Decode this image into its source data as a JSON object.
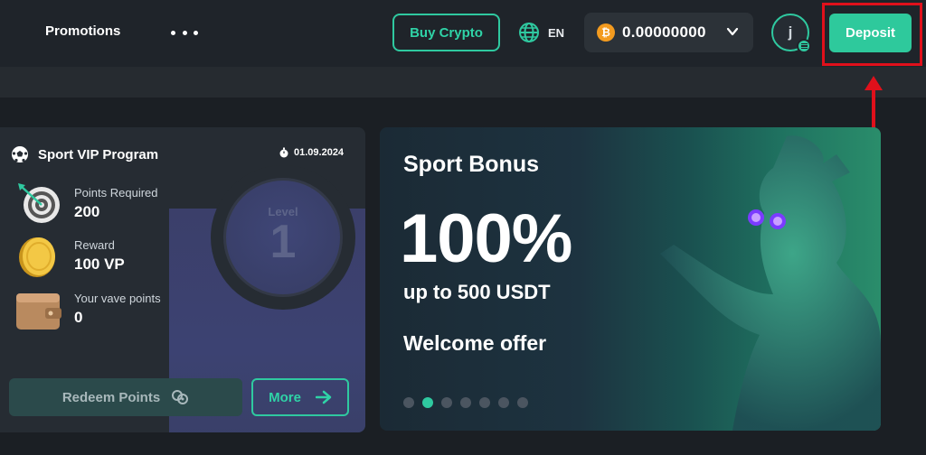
{
  "header": {
    "promotions_label": "Promotions",
    "buy_crypto_label": "Buy Crypto",
    "language": "EN",
    "balance": "0.00000000",
    "currency_icon": "bitcoin-icon",
    "avatar_letter": "j",
    "deposit_label": "Deposit"
  },
  "vip": {
    "title": "Sport VIP Program",
    "date": "01.09.2024",
    "level_label": "Level",
    "level_value": "1",
    "stats": [
      {
        "label": "Points Required",
        "value": "200",
        "icon": "target-icon"
      },
      {
        "label": "Reward",
        "value": "100 VP",
        "icon": "coin-icon"
      },
      {
        "label": "Your vave points",
        "value": "0",
        "icon": "wallet-icon"
      }
    ],
    "redeem_label": "Redeem Points",
    "more_label": "More"
  },
  "banner": {
    "title": "Sport Bonus",
    "headline": "100%",
    "subline": "up to 500 USDT",
    "offer": "Welcome offer",
    "slides_count": 7,
    "active_slide": 2
  },
  "colors": {
    "accent": "#2fc9a0",
    "background": "#1b1f24",
    "highlight": "#e0101b",
    "bitcoin": "#f39b1f"
  }
}
